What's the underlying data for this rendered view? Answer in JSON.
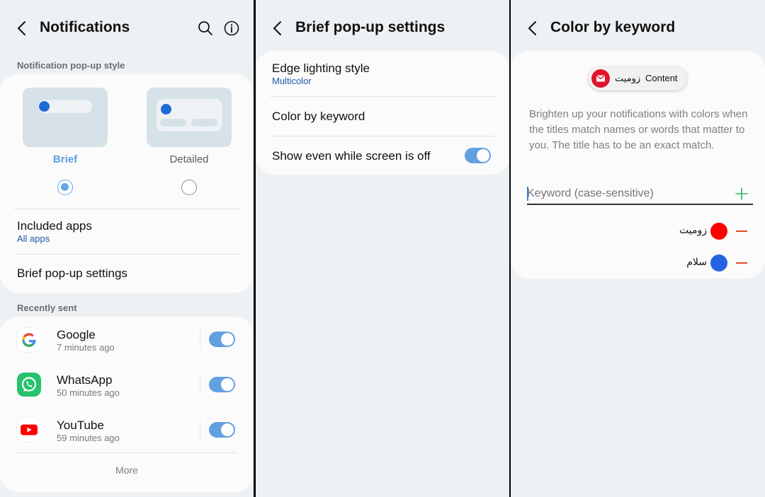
{
  "screen1": {
    "title": "Notifications",
    "icons": {
      "back": "back-arrow-icon",
      "search": "search-icon",
      "info": "info-icon"
    },
    "popup_style_label": "Notification pop-up style",
    "styles": [
      {
        "label": "Brief",
        "selected": true
      },
      {
        "label": "Detailed",
        "selected": false
      }
    ],
    "included_apps": {
      "title": "Included apps",
      "value": "All apps"
    },
    "brief_settings": "Brief pop-up settings",
    "recently_sent_label": "Recently sent",
    "apps": [
      {
        "name": "Google",
        "time": "7 minutes ago",
        "enabled": true,
        "icon": "google-icon"
      },
      {
        "name": "WhatsApp",
        "time": "50 minutes ago",
        "enabled": true,
        "icon": "whatsapp-icon"
      },
      {
        "name": "YouTube",
        "time": "59 minutes ago",
        "enabled": true,
        "icon": "youtube-icon"
      }
    ],
    "more": "More"
  },
  "screen2": {
    "title": "Brief pop-up settings",
    "edge_lighting": {
      "title": "Edge lighting style",
      "value": "Multicolor"
    },
    "color_by_keyword": "Color by keyword",
    "show_screen_off": {
      "title": "Show even while screen is off",
      "enabled": true
    }
  },
  "screen3": {
    "title": "Color by keyword",
    "preview": {
      "keyword": "زومیت",
      "content": "Content",
      "icon": "mail-icon"
    },
    "description": "Brighten up your notifications with colors when the titles match names or words that matter to you. The title has to be an exact match.",
    "input_placeholder": "Keyword (case-sensitive)",
    "keywords": [
      {
        "text": "زومیت",
        "color": "#ff0000"
      },
      {
        "text": "سلام",
        "color": "#2463e0"
      }
    ]
  },
  "colors": {
    "accent": "#62a0df",
    "link": "#1d5aa8",
    "background": "#eef1f4",
    "card": "#fbfbfb",
    "remove": "#e2492c",
    "add": "#38b26a"
  }
}
